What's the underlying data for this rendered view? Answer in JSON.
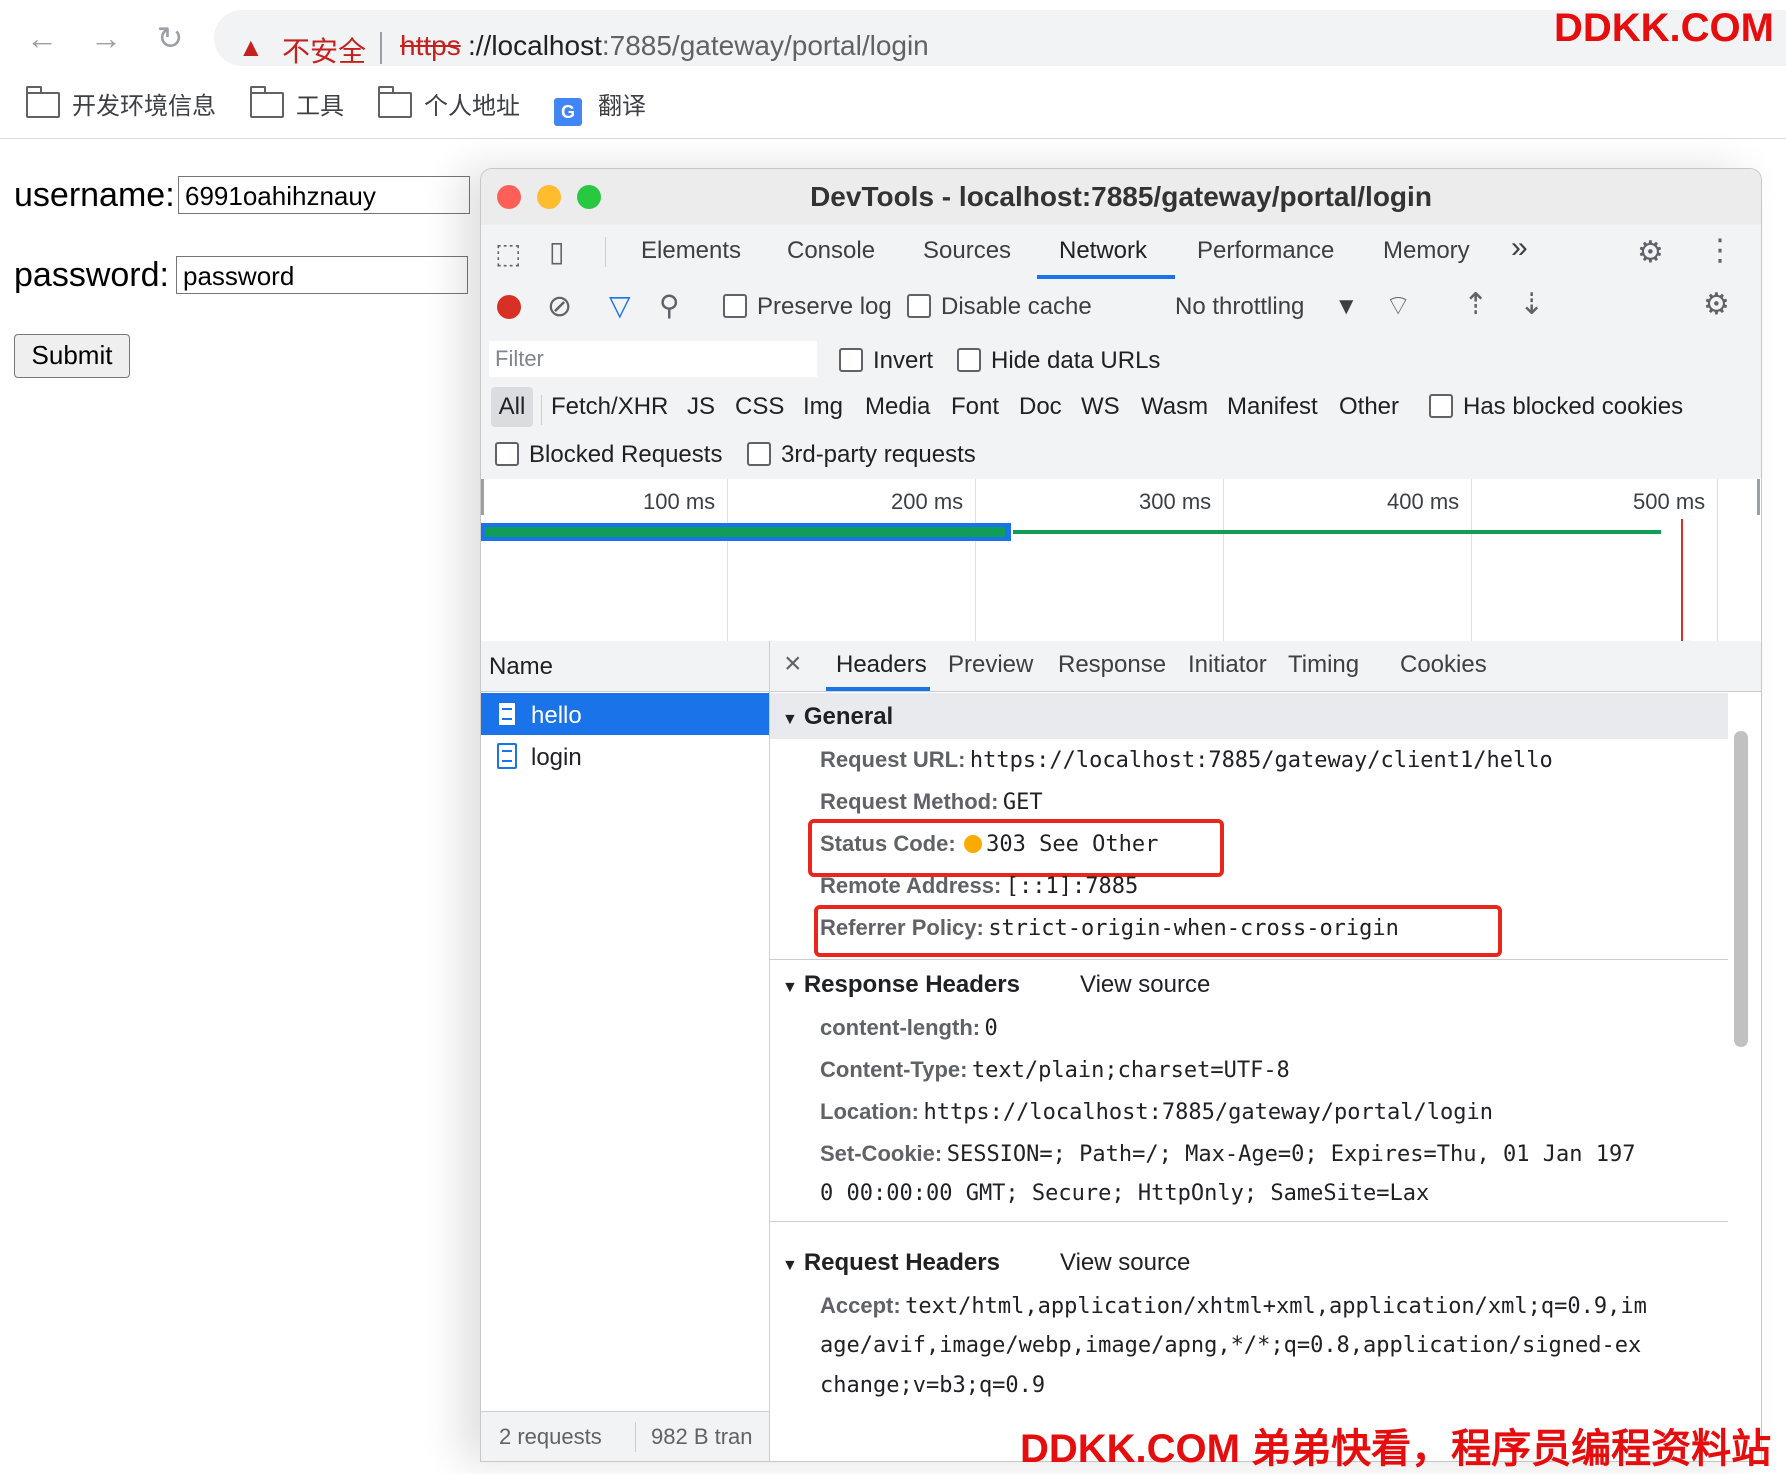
{
  "browser": {
    "security_label": "不安全",
    "url_scheme": "https",
    "url_host": "://localhost",
    "url_path": ":7885/gateway/portal/login",
    "bookmarks": [
      {
        "label": "开发环境信息",
        "icon": "folder-icon"
      },
      {
        "label": "工具",
        "icon": "folder-icon"
      },
      {
        "label": "个人地址",
        "icon": "folder-icon"
      },
      {
        "label": "翻译",
        "icon": "google-translate-icon"
      }
    ],
    "translate_glyph": "G"
  },
  "watermark": {
    "top": "DDKK.COM",
    "bottom": "DDKK.COM 弟弟快看，程序员编程资料站"
  },
  "form": {
    "username_label": "username:",
    "username_value": "6991oahihznauy",
    "password_label": "password:",
    "password_value": "password",
    "submit_label": "Submit"
  },
  "devtools": {
    "title": "DevTools - localhost:7885/gateway/portal/login",
    "tabs": [
      "Elements",
      "Console",
      "Sources",
      "Network",
      "Performance",
      "Memory"
    ],
    "more_tabs": "»",
    "active_tab": "Network",
    "toolbar": {
      "preserve_log": "Preserve log",
      "disable_cache": "Disable cache",
      "throttling": "No throttling"
    },
    "filter": {
      "placeholder": "Filter",
      "invert": "Invert",
      "hide_data_urls": "Hide data URLs",
      "types": [
        "All",
        "Fetch/XHR",
        "JS",
        "CSS",
        "Img",
        "Media",
        "Font",
        "Doc",
        "WS",
        "Wasm",
        "Manifest",
        "Other"
      ],
      "has_blocked_cookies": "Has blocked cookies",
      "blocked_requests": "Blocked Requests",
      "third_party": "3rd-party requests"
    },
    "overview": {
      "ticks": [
        "100 ms",
        "200 ms",
        "300 ms",
        "400 ms",
        "500 ms"
      ]
    },
    "requests": {
      "header": "Name",
      "items": [
        "hello",
        "login"
      ],
      "selected": "hello",
      "summary_count": "2 requests",
      "summary_transfer": "982 B tran"
    },
    "detail_tabs": [
      "Headers",
      "Preview",
      "Response",
      "Initiator",
      "Timing",
      "Cookies"
    ],
    "close_glyph": "×",
    "general": {
      "title": "General",
      "request_url_key": "Request URL:",
      "request_url": "https://localhost:7885/gateway/client1/hello",
      "method_key": "Request Method:",
      "method": "GET",
      "status_key": "Status Code:",
      "status": "303 See Other",
      "remote_key": "Remote Address:",
      "remote": "[::1]:7885",
      "referrer_key": "Referrer Policy:",
      "referrer": "strict-origin-when-cross-origin"
    },
    "response_headers": {
      "title": "Response Headers",
      "view_source": "View source",
      "content_length_key": "content-length:",
      "content_length": "0",
      "content_type_key": "Content-Type:",
      "content_type": "text/plain;charset=UTF-8",
      "location_key": "Location:",
      "location": "https://localhost:7885/gateway/portal/login",
      "set_cookie_key": "Set-Cookie:",
      "set_cookie_1": "SESSION=; Path=/; Max-Age=0; Expires=Thu, 01 Jan 197",
      "set_cookie_2": "0 00:00:00 GMT; Secure; HttpOnly; SameSite=Lax"
    },
    "request_headers": {
      "title": "Request Headers",
      "view_source": "View source",
      "accept_key": "Accept:",
      "accept_1": "text/html,application/xhtml+xml,application/xml;q=0.9,im",
      "accept_2": "age/avif,image/webp,image/apng,*/*;q=0.8,application/signed-ex",
      "accept_3": "change;v=b3;q=0.9"
    }
  }
}
